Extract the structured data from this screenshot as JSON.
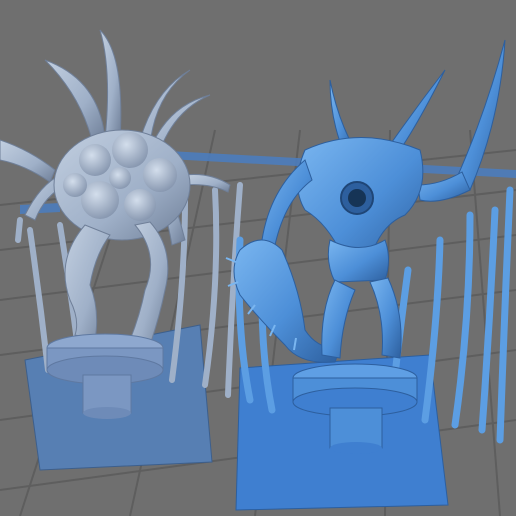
{
  "viewport": {
    "background": "#6f6f6f",
    "grid_color": "#5c5c5c",
    "plate_color": "#4a7ec2",
    "model_gray": "#9fb0c8",
    "model_gray_shadow": "#6f7f98",
    "model_blue": "#4d8fd8",
    "model_blue_shadow": "#2d5f9e",
    "support_gray": "#a9b9cf",
    "support_blue": "#5c9ee3"
  },
  "models": [
    {
      "id": "tentacle-creature",
      "color": "gray"
    },
    {
      "id": "mouth-demon",
      "color": "blue",
      "selected": true
    }
  ]
}
